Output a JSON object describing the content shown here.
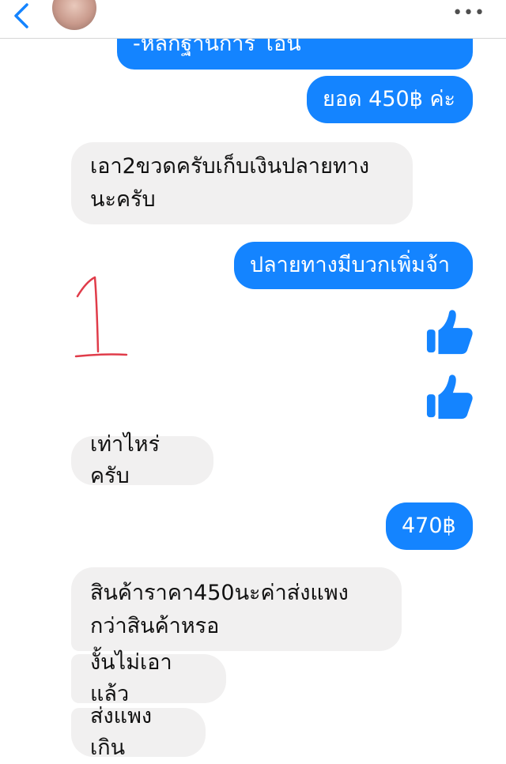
{
  "header": {
    "back_icon": "chevron-left-icon",
    "more_label": "•••"
  },
  "messages": [
    {
      "id": "m0",
      "side": "out",
      "text": "-หลกฐานการ โอน"
    },
    {
      "id": "m1",
      "side": "out",
      "text": "ยอด 450฿ ค่ะ"
    },
    {
      "id": "m2",
      "side": "in",
      "text": "เอา2ขวดครับเก็บเงินปลายทางนะครับ"
    },
    {
      "id": "m3",
      "side": "out",
      "text": "ปลายทางมีบวกเพิ่มจ้า"
    },
    {
      "id": "m4",
      "side": "out",
      "type": "like",
      "icon": "thumbs-up-icon"
    },
    {
      "id": "m5",
      "side": "out",
      "type": "like",
      "icon": "thumbs-up-icon"
    },
    {
      "id": "m6",
      "side": "in",
      "text": "เท่าไหร่ครับ"
    },
    {
      "id": "m7",
      "side": "out",
      "text": "470฿"
    },
    {
      "id": "m8",
      "side": "in",
      "text": "สินค้าราคา450นะค่าส่งแพงกว่าสินค้าหรอ"
    },
    {
      "id": "m9",
      "side": "in",
      "text": "งั้นไม่เอาแล้ว"
    },
    {
      "id": "m10",
      "side": "in",
      "text": "ส่งแพงเกิน"
    }
  ],
  "annotation": {
    "text": "1",
    "color": "#e03c4a"
  },
  "colors": {
    "outgoing": "#1484ff",
    "incoming": "#f1f0f0",
    "like": "#1484ff"
  }
}
